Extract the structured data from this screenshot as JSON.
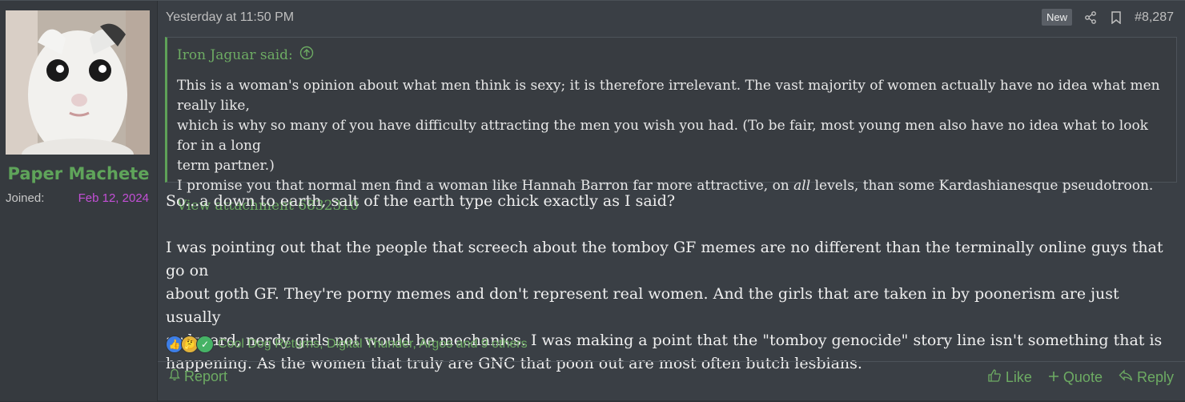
{
  "user": {
    "name": "Paper Machete",
    "joined_label": "Joined:",
    "joined_value": "Feb 12, 2024"
  },
  "post": {
    "timestamp": "Yesterday at 11:50 PM",
    "new_badge": "New",
    "post_number": "#8,287"
  },
  "quote": {
    "author_line": "Iron Jaguar said:",
    "lines": [
      "This is a woman's opinion about what men think is sexy; it is therefore irrelevant. The vast majority of women actually have no idea what men really like,",
      "which is why so many of you have difficulty attracting the men you wish you had. (To be fair, most young men also have no idea what to look for in a long",
      "term partner.)"
    ],
    "line_promise_a": "I promise you that normal men find a woman like Hannah Barron far more attractive, on ",
    "line_promise_em": "all",
    "line_promise_b": " levels, than some Kardashianesque pseudotroon.",
    "attachment": "View attachment 6832310"
  },
  "message": {
    "p1": "So...a down to earth, salt of the earth type chick exactly as I said?",
    "p2_lines": [
      "I was pointing out that the people that screech about the tomboy GF memes are no different than the terminally online guys that go on",
      "about goth GF. They're porny memes and don't represent real women. And the girls that are taken in by poonerism are just usually",
      "awkward, nerdy girls not would be mechanics. I was making a point that the \"tomboy genocide\" story line isn't something that is",
      "happening. As the women that truly are GNC that poon out are most often butch lesbians."
    ]
  },
  "reactions": {
    "text": "Cool Dog Returns, Digital Thunder, Argos and 9 others",
    "icons": [
      "thumbs-up-icon",
      "thinking-face-icon",
      "check-icon"
    ]
  },
  "footer": {
    "report": "Report",
    "like": "Like",
    "quote": "Quote",
    "reply": "Reply"
  },
  "colors": {
    "accent_green": "#6dab63",
    "joined_purple": "#c34fd6",
    "username_green": "#5fa45a"
  }
}
